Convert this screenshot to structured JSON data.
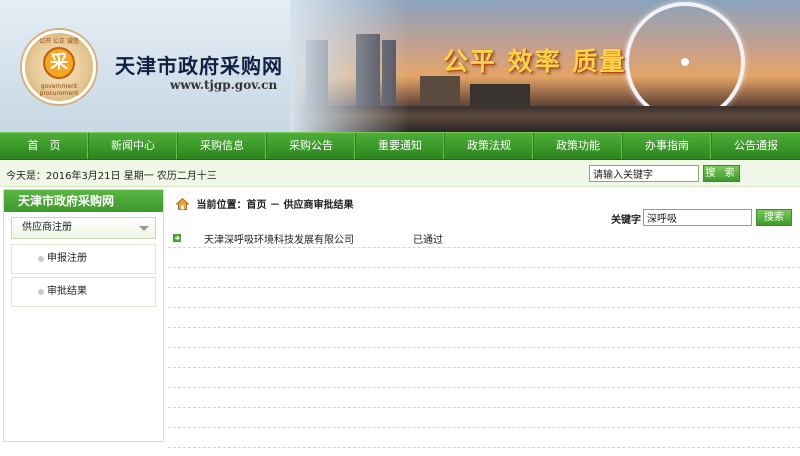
{
  "header": {
    "site_name": "天津市政府采购网",
    "site_url": "www.tjgp.gov.cn",
    "emblem_char": "采",
    "emblem_top_text": "公开 公正 诚信",
    "emblem_bottom_text": "government procurement",
    "slogan": "公平  效率  质量"
  },
  "nav": {
    "items": [
      "首　页",
      "新闻中心",
      "采购信息",
      "采购公告",
      "重要通知",
      "政策法规",
      "政策功能",
      "办事指南",
      "公告通报"
    ]
  },
  "infobar": {
    "date_text": "今天是：2016年3月21日 星期一  农历二月十三",
    "search_placeholder": "请输入关键字",
    "search_button": "搜 索"
  },
  "sidebar": {
    "title": "天津市政府采购网",
    "menu_header": "供应商注册",
    "items": [
      "申报注册",
      "审批结果"
    ]
  },
  "main": {
    "breadcrumb": "当前位置：首页 － 供应商审批结果",
    "keyword_label": "关键字",
    "keyword_value": "深呼吸",
    "search_button": "搜索",
    "results": [
      {
        "company": "天津深呼吸环境科技发展有限公司",
        "status": "已通过"
      }
    ]
  },
  "colors": {
    "nav_green": "#3c9a2a",
    "infobar_bg": "#f1f7e7",
    "slogan_gold": "#ffd24a"
  }
}
